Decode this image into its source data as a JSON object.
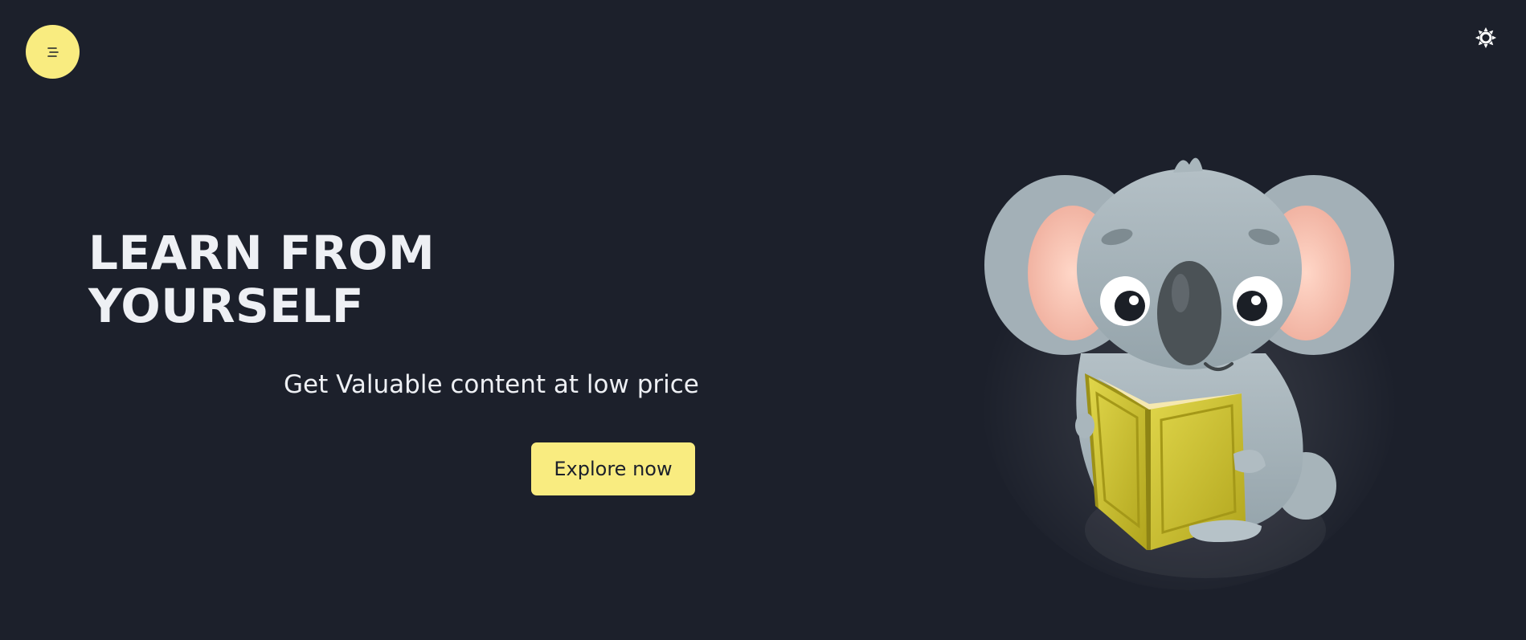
{
  "header": {
    "menu_icon": "menu-lines-icon",
    "theme_icon": "sun-icon"
  },
  "hero": {
    "title": "LEARN FROM YOURSELF",
    "subtitle": "Get Valuable content at low price",
    "cta_label": "Explore now",
    "illustration": "koala-reading-book"
  },
  "colors": {
    "background": "#1c202b",
    "accent": "#f9ec80",
    "text": "#eef0f4"
  }
}
